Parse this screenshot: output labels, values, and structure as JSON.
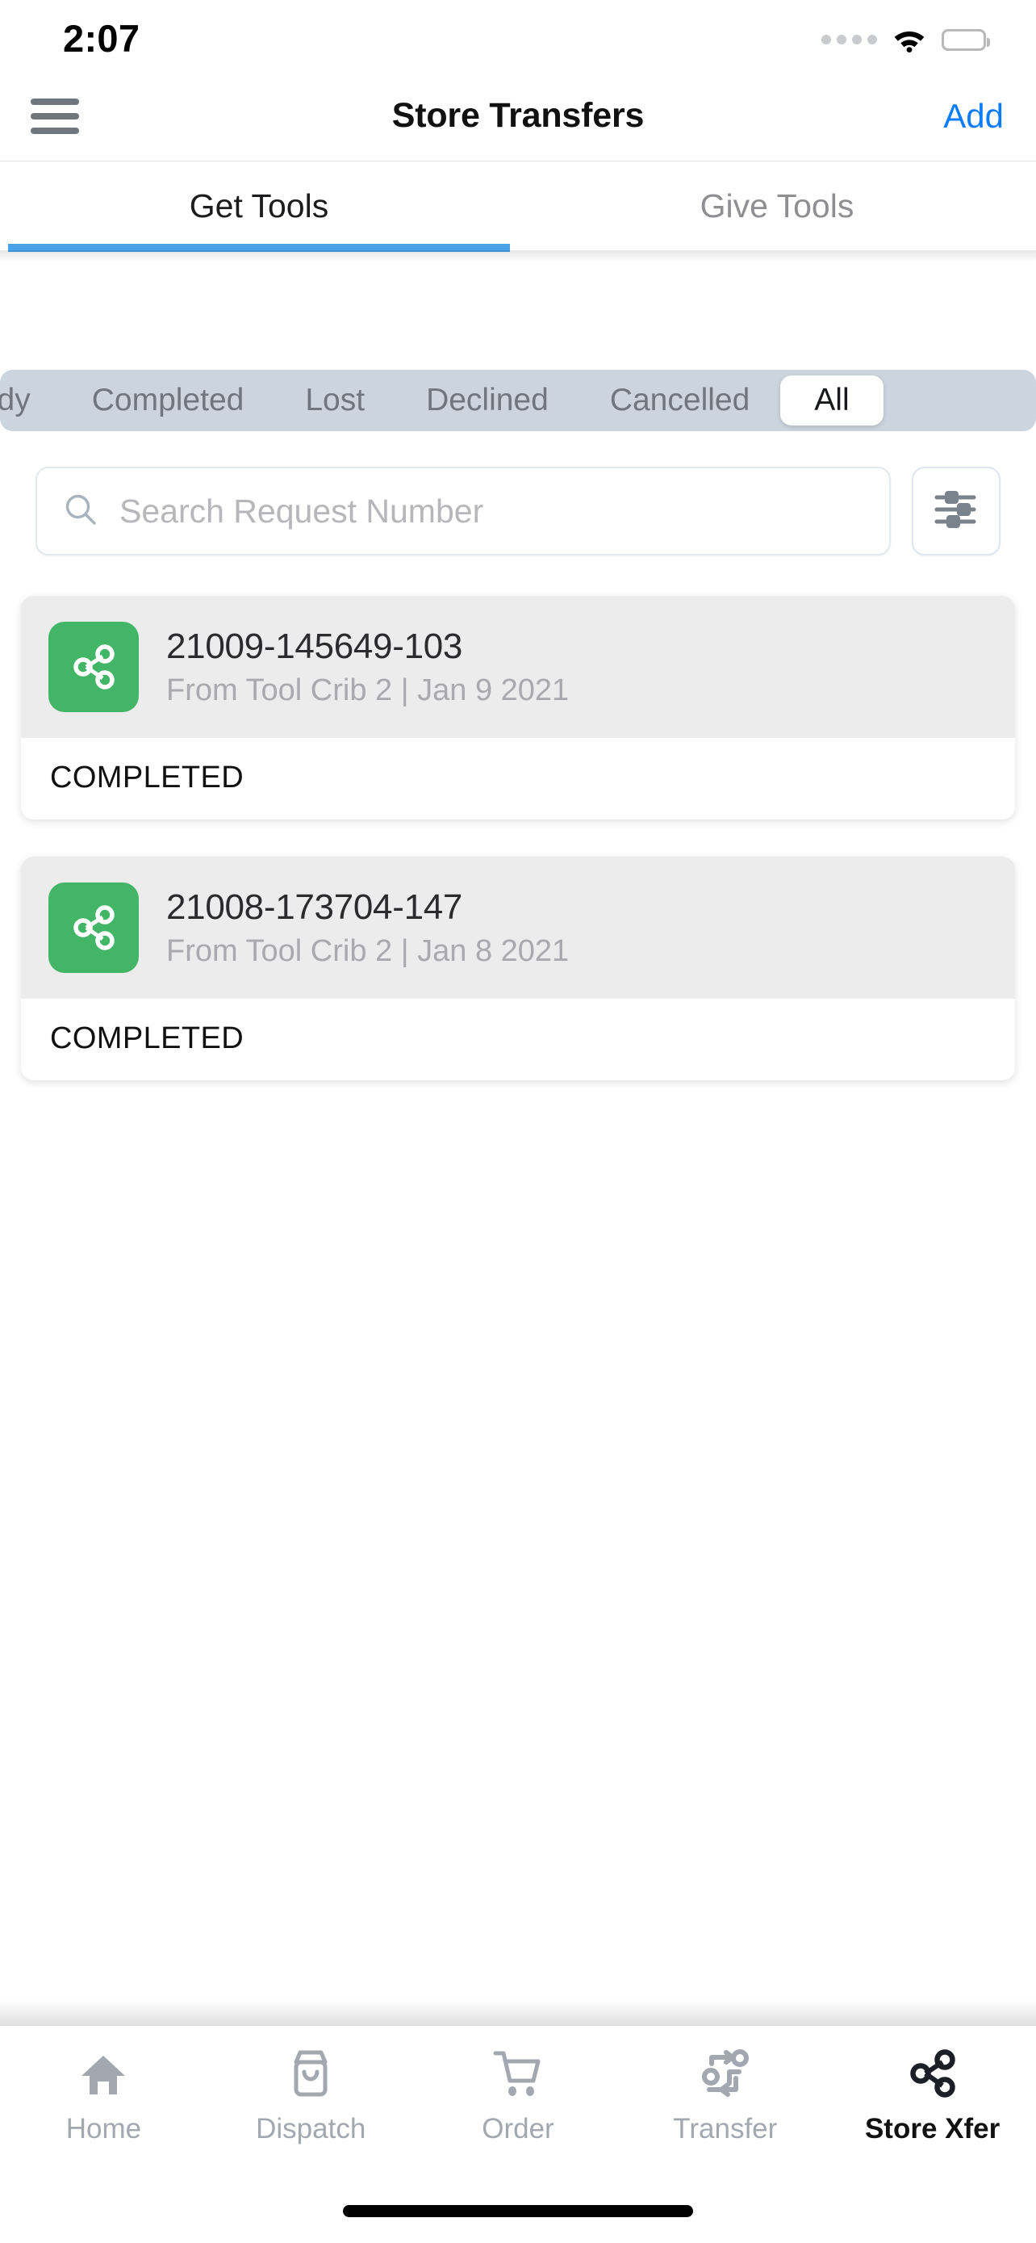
{
  "status_bar": {
    "time": "2:07",
    "cellular_icon": "signal-dots-icon",
    "wifi_icon": "wifi-icon",
    "battery_icon": "battery-full-icon"
  },
  "nav": {
    "menu_icon": "hamburger-menu-icon",
    "title": "Store Transfers",
    "add_label": "Add"
  },
  "top_tabs": {
    "items": [
      {
        "label": "Get Tools",
        "active": true
      },
      {
        "label": "Give Tools",
        "active": false
      }
    ]
  },
  "segmented_filter": {
    "options": [
      "Ready",
      "Completed",
      "Lost",
      "Declined",
      "Cancelled",
      "All"
    ],
    "selected": "All"
  },
  "search": {
    "placeholder": "Search Request Number",
    "value": "",
    "icon": "search-icon",
    "filter_button_icon": "sliders-filter-icon"
  },
  "list": {
    "items": [
      {
        "icon": "share-nodes-icon",
        "request_number": "21009-145649-103",
        "meta": "From Tool Crib 2 | Jan 9 2021",
        "status": "COMPLETED"
      },
      {
        "icon": "share-nodes-icon",
        "request_number": "21008-173704-147",
        "meta": "From Tool Crib 2 | Jan 8 2021",
        "status": "COMPLETED"
      }
    ]
  },
  "bottom_tabs": {
    "items": [
      {
        "label": "Home",
        "icon": "home-icon",
        "active": false
      },
      {
        "label": "Dispatch",
        "icon": "shopping-bag-icon",
        "active": false
      },
      {
        "label": "Order",
        "icon": "shopping-cart-icon",
        "active": false
      },
      {
        "label": "Transfer",
        "icon": "transfer-nodes-icon",
        "active": false
      },
      {
        "label": "Store Xfer",
        "icon": "share-nodes-icon",
        "active": true
      }
    ]
  },
  "colors": {
    "accent_blue": "#0a7cff",
    "tab_underline_blue": "#4aa3e8",
    "card_icon_green": "#43b566",
    "segment_track": "#ccd4dd",
    "muted_text": "#8e8e93"
  }
}
